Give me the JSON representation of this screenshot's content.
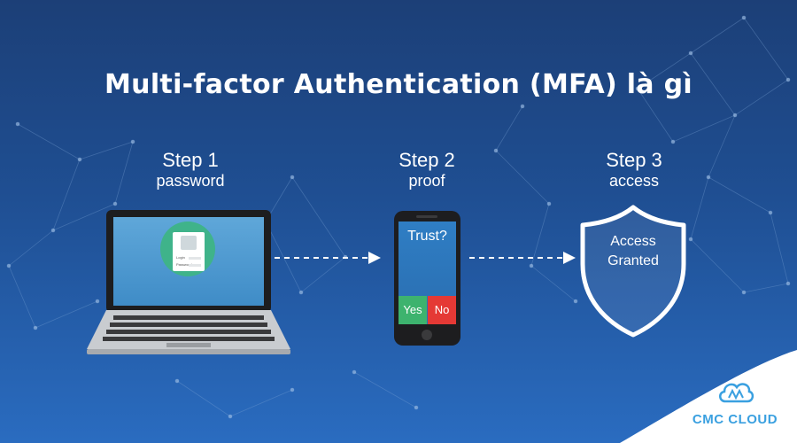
{
  "title": "Multi-factor Authentication (MFA) là gì",
  "steps": [
    {
      "heading": "Step 1",
      "label": "password"
    },
    {
      "heading": "Step 2",
      "label": "proof"
    },
    {
      "heading": "Step 3",
      "label": "access"
    }
  ],
  "laptop": {
    "login_fields": [
      "Login",
      "Password"
    ]
  },
  "phone": {
    "prompt": "Trust?",
    "yes_label": "Yes",
    "no_label": "No",
    "yes_color": "#3db36e",
    "no_color": "#e53935"
  },
  "shield": {
    "line1": "Access",
    "line2": "Granted"
  },
  "brand": {
    "name": "CMC CLOUD",
    "color": "#3aa0e0"
  },
  "colors": {
    "background_top": "#1c3f77",
    "background_bottom": "#2a6cc0",
    "accent_green": "#3fb38a"
  }
}
